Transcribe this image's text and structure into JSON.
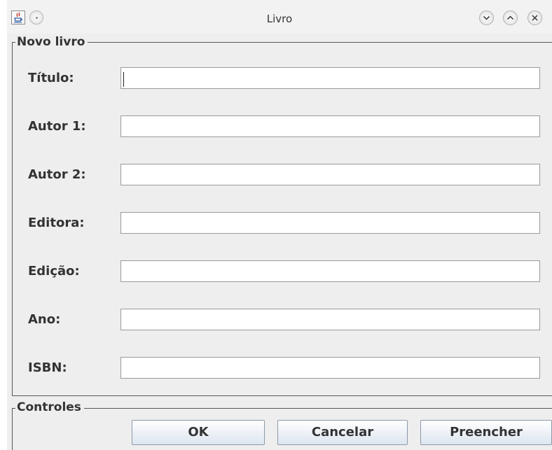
{
  "window": {
    "title": "Livro",
    "icon": "java-icon",
    "controls": [
      "minimize-icon",
      "maximize-icon",
      "close-icon"
    ]
  },
  "form": {
    "legend": "Novo livro",
    "fields": [
      {
        "label": "Título:",
        "value": ""
      },
      {
        "label": "Autor 1:",
        "value": ""
      },
      {
        "label": "Autor 2:",
        "value": ""
      },
      {
        "label": "Editora:",
        "value": ""
      },
      {
        "label": "Edição:",
        "value": ""
      },
      {
        "label": "Ano:",
        "value": ""
      },
      {
        "label": "ISBN:",
        "value": ""
      }
    ]
  },
  "controls": {
    "legend": "Controles",
    "ok_label": "OK",
    "cancel_label": "Cancelar",
    "fill_label": "Preencher"
  },
  "colors": {
    "window_bg": "#eeeeee",
    "accent_edge": "#5fb8a8",
    "button_gradient_end": "#dce5ef"
  }
}
